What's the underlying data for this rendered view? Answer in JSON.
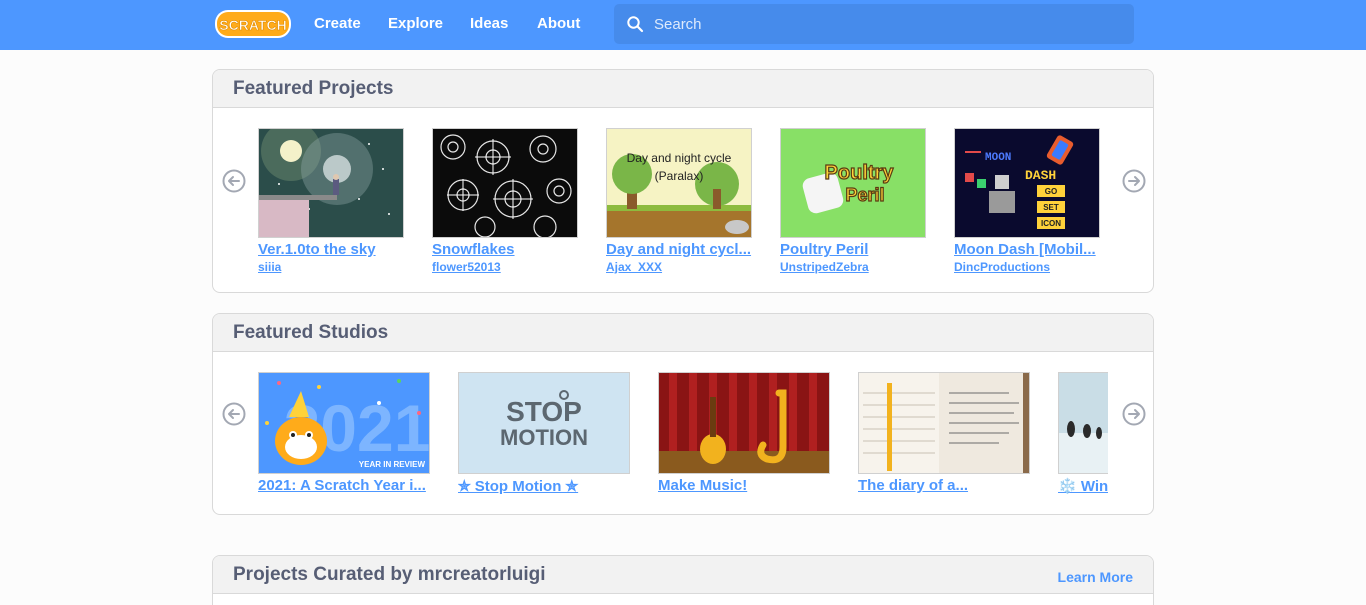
{
  "nav": {
    "logo_text": "SCRATCH",
    "links": [
      "Create",
      "Explore",
      "Ideas",
      "About"
    ],
    "search_placeholder": "Search",
    "colors": {
      "bar": "#4d97ff",
      "logo": "#ffab1a"
    }
  },
  "featured_projects": {
    "title": "Featured Projects",
    "items": [
      {
        "title": "Ver.1.0to the sky",
        "owner": "siiia"
      },
      {
        "title": "Snowflakes",
        "owner": "flower52013"
      },
      {
        "title": "Day and night cycl...",
        "owner": "Ajax_XXX",
        "thumb_text": [
          "Day and night cycle",
          "(Paralax)"
        ]
      },
      {
        "title": "Poultry Peril",
        "owner": "UnstripedZebra",
        "thumb_text": [
          "Poultry",
          "Peril"
        ]
      },
      {
        "title": "Moon Dash [Mobil...",
        "owner": "DincProductions",
        "thumb_text": [
          "MOON",
          "DASH",
          "GO",
          "SET",
          "ICON"
        ]
      }
    ]
  },
  "featured_studios": {
    "title": "Featured Studios",
    "items": [
      {
        "title": "2021: A Scratch Year i...",
        "thumb_text": [
          "2021",
          "YEAR IN REVIEW"
        ]
      },
      {
        "title": "✮ Stop Motion ✮",
        "thumb_text": [
          "STOP",
          "MOTION"
        ]
      },
      {
        "title": "Make Music!"
      },
      {
        "title": "The diary of a..."
      },
      {
        "title": "❄️ Win"
      }
    ]
  },
  "curated": {
    "title": "Projects Curated by mrcreatorluigi",
    "learn_more": "Learn More"
  }
}
